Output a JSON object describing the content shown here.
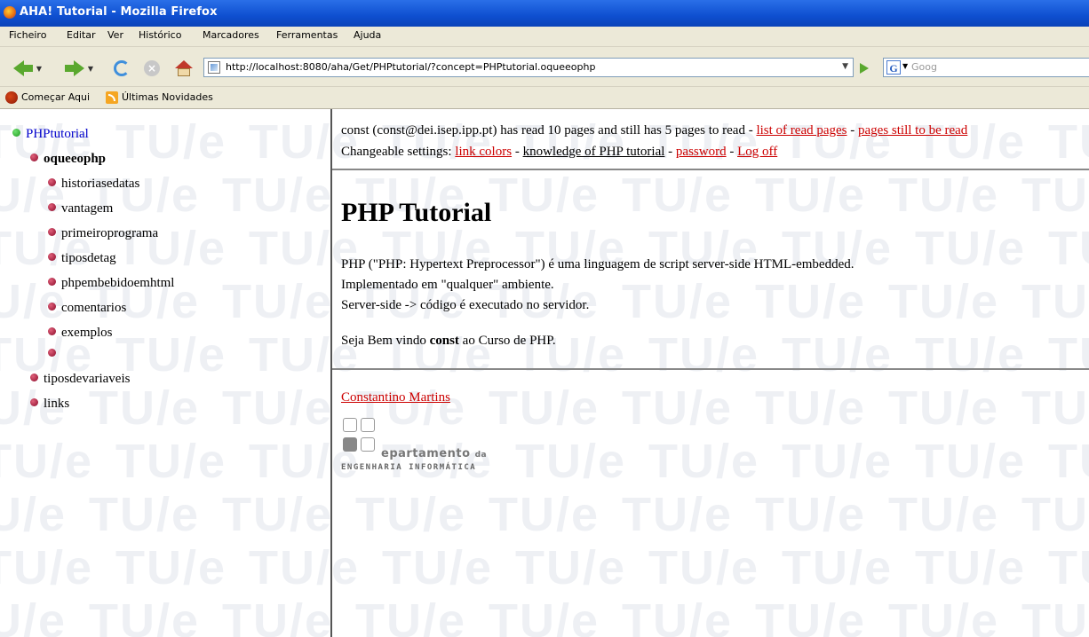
{
  "window": {
    "title": "AHA! Tutorial - Mozilla Firefox"
  },
  "menu": [
    "Ficheiro",
    "Editar",
    "Ver",
    "Histórico",
    "Marcadores",
    "Ferramentas",
    "Ajuda"
  ],
  "navbar": {
    "url": "http://localhost:8080/aha/Get/PHPtutorial/?concept=PHPtutorial.oqueeophp",
    "search_placeholder": "Goog"
  },
  "bookmarks": [
    "Começar Aqui",
    "Últimas Novidades"
  ],
  "watermark": "TU/e",
  "sidebar": {
    "root": "PHPtutorial",
    "current": "oqueeophp",
    "children": [
      "historiasedatas",
      "vantagem",
      "primeiroprograma",
      "tiposdetag",
      "phpembebidoemhtml",
      "comentarios",
      "exemplos",
      ""
    ],
    "siblings": [
      "tiposdevariaveis",
      "links"
    ]
  },
  "header": {
    "status_text": "const (const@dei.isep.ipp.pt) has read 10 pages and still has 5 pages to read - ",
    "read_link": "list of read pages",
    "sep1": " - ",
    "unread_link": "pages still to be read",
    "settings_label": "Changeable settings: ",
    "link_colors": "link colors",
    "sep2": " - ",
    "knowledge": "knowledge of PHP tutorial",
    "sep3": " - ",
    "password": "password",
    "sep4": " - ",
    "logoff": "Log off"
  },
  "article": {
    "title": "PHP Tutorial",
    "p1": "PHP (\"PHP: Hypertext Preprocessor\") é uma linguagem de script server-side HTML-embedded.",
    "p2": "Implementado em \"qualquer\" ambiente.",
    "p3": "Server-side -> código é executado no servidor.",
    "welcome_pre": "Seja Bem vindo ",
    "welcome_user": "const",
    "welcome_post": " ao Curso de PHP."
  },
  "footer": {
    "author": "Constantino Martins",
    "logo_line1": "epartamento",
    "logo_line1_small": "da",
    "logo_line2": "ENGENHARIA INFORMÁTICA"
  }
}
